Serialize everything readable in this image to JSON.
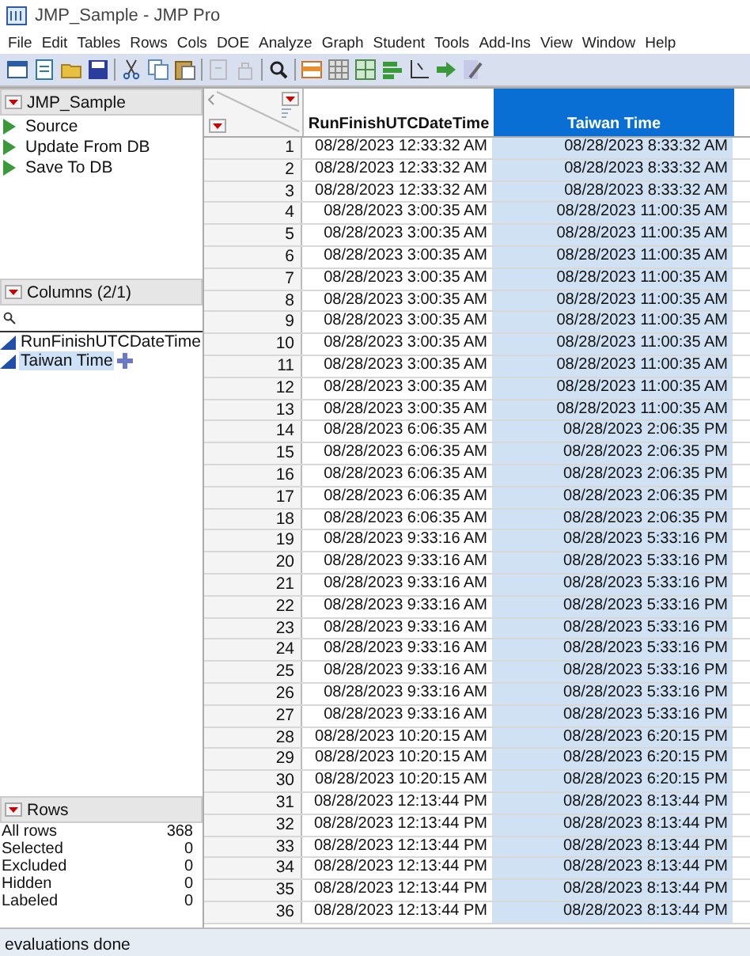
{
  "window": {
    "title": "JMP_Sample - JMP Pro"
  },
  "menu": [
    "File",
    "Edit",
    "Tables",
    "Rows",
    "Cols",
    "DOE",
    "Analyze",
    "Graph",
    "Student",
    "Tools",
    "Add-Ins",
    "View",
    "Window",
    "Help"
  ],
  "table_panel": {
    "title": "JMP_Sample",
    "scripts": [
      "Source",
      "Update From DB",
      "Save To DB"
    ]
  },
  "columns_panel": {
    "title": "Columns (2/1)",
    "columns": [
      {
        "name": "RunFinishUTCDateTime",
        "selected": false
      },
      {
        "name": "Taiwan Time",
        "selected": true
      }
    ]
  },
  "rows_panel": {
    "title": "Rows",
    "stats": [
      {
        "label": "All rows",
        "value": "368"
      },
      {
        "label": "Selected",
        "value": "0"
      },
      {
        "label": "Excluded",
        "value": "0"
      },
      {
        "label": "Hidden",
        "value": "0"
      },
      {
        "label": "Labeled",
        "value": "0"
      }
    ]
  },
  "table": {
    "columns": [
      {
        "name": "RunFinishUTCDateTime",
        "selected": false
      },
      {
        "name": "Taiwan Time",
        "selected": true
      }
    ],
    "rows": [
      {
        "number": "1",
        "cells": [
          "08/28/2023 12:33:32 AM",
          "08/28/2023 8:33:32 AM"
        ]
      },
      {
        "number": "2",
        "cells": [
          "08/28/2023 12:33:32 AM",
          "08/28/2023 8:33:32 AM"
        ]
      },
      {
        "number": "3",
        "cells": [
          "08/28/2023 12:33:32 AM",
          "08/28/2023 8:33:32 AM"
        ]
      },
      {
        "number": "4",
        "cells": [
          "08/28/2023 3:00:35 AM",
          "08/28/2023 11:00:35 AM"
        ]
      },
      {
        "number": "5",
        "cells": [
          "08/28/2023 3:00:35 AM",
          "08/28/2023 11:00:35 AM"
        ]
      },
      {
        "number": "6",
        "cells": [
          "08/28/2023 3:00:35 AM",
          "08/28/2023 11:00:35 AM"
        ]
      },
      {
        "number": "7",
        "cells": [
          "08/28/2023 3:00:35 AM",
          "08/28/2023 11:00:35 AM"
        ]
      },
      {
        "number": "8",
        "cells": [
          "08/28/2023 3:00:35 AM",
          "08/28/2023 11:00:35 AM"
        ]
      },
      {
        "number": "9",
        "cells": [
          "08/28/2023 3:00:35 AM",
          "08/28/2023 11:00:35 AM"
        ]
      },
      {
        "number": "10",
        "cells": [
          "08/28/2023 3:00:35 AM",
          "08/28/2023 11:00:35 AM"
        ]
      },
      {
        "number": "11",
        "cells": [
          "08/28/2023 3:00:35 AM",
          "08/28/2023 11:00:35 AM"
        ]
      },
      {
        "number": "12",
        "cells": [
          "08/28/2023 3:00:35 AM",
          "08/28/2023 11:00:35 AM"
        ]
      },
      {
        "number": "13",
        "cells": [
          "08/28/2023 3:00:35 AM",
          "08/28/2023 11:00:35 AM"
        ]
      },
      {
        "number": "14",
        "cells": [
          "08/28/2023 6:06:35 AM",
          "08/28/2023 2:06:35 PM"
        ]
      },
      {
        "number": "15",
        "cells": [
          "08/28/2023 6:06:35 AM",
          "08/28/2023 2:06:35 PM"
        ]
      },
      {
        "number": "16",
        "cells": [
          "08/28/2023 6:06:35 AM",
          "08/28/2023 2:06:35 PM"
        ]
      },
      {
        "number": "17",
        "cells": [
          "08/28/2023 6:06:35 AM",
          "08/28/2023 2:06:35 PM"
        ]
      },
      {
        "number": "18",
        "cells": [
          "08/28/2023 6:06:35 AM",
          "08/28/2023 2:06:35 PM"
        ]
      },
      {
        "number": "19",
        "cells": [
          "08/28/2023 9:33:16 AM",
          "08/28/2023 5:33:16 PM"
        ]
      },
      {
        "number": "20",
        "cells": [
          "08/28/2023 9:33:16 AM",
          "08/28/2023 5:33:16 PM"
        ]
      },
      {
        "number": "21",
        "cells": [
          "08/28/2023 9:33:16 AM",
          "08/28/2023 5:33:16 PM"
        ]
      },
      {
        "number": "22",
        "cells": [
          "08/28/2023 9:33:16 AM",
          "08/28/2023 5:33:16 PM"
        ]
      },
      {
        "number": "23",
        "cells": [
          "08/28/2023 9:33:16 AM",
          "08/28/2023 5:33:16 PM"
        ]
      },
      {
        "number": "24",
        "cells": [
          "08/28/2023 9:33:16 AM",
          "08/28/2023 5:33:16 PM"
        ]
      },
      {
        "number": "25",
        "cells": [
          "08/28/2023 9:33:16 AM",
          "08/28/2023 5:33:16 PM"
        ]
      },
      {
        "number": "26",
        "cells": [
          "08/28/2023 9:33:16 AM",
          "08/28/2023 5:33:16 PM"
        ]
      },
      {
        "number": "27",
        "cells": [
          "08/28/2023 9:33:16 AM",
          "08/28/2023 5:33:16 PM"
        ]
      },
      {
        "number": "28",
        "cells": [
          "08/28/2023 10:20:15 AM",
          "08/28/2023 6:20:15 PM"
        ]
      },
      {
        "number": "29",
        "cells": [
          "08/28/2023 10:20:15 AM",
          "08/28/2023 6:20:15 PM"
        ]
      },
      {
        "number": "30",
        "cells": [
          "08/28/2023 10:20:15 AM",
          "08/28/2023 6:20:15 PM"
        ]
      },
      {
        "number": "31",
        "cells": [
          "08/28/2023 12:13:44 PM",
          "08/28/2023 8:13:44 PM"
        ]
      },
      {
        "number": "32",
        "cells": [
          "08/28/2023 12:13:44 PM",
          "08/28/2023 8:13:44 PM"
        ]
      },
      {
        "number": "33",
        "cells": [
          "08/28/2023 12:13:44 PM",
          "08/28/2023 8:13:44 PM"
        ]
      },
      {
        "number": "34",
        "cells": [
          "08/28/2023 12:13:44 PM",
          "08/28/2023 8:13:44 PM"
        ]
      },
      {
        "number": "35",
        "cells": [
          "08/28/2023 12:13:44 PM",
          "08/28/2023 8:13:44 PM"
        ]
      },
      {
        "number": "36",
        "cells": [
          "08/28/2023 12:13:44 PM",
          "08/28/2023 8:13:44 PM"
        ]
      }
    ]
  },
  "status_bar": "evaluations done"
}
